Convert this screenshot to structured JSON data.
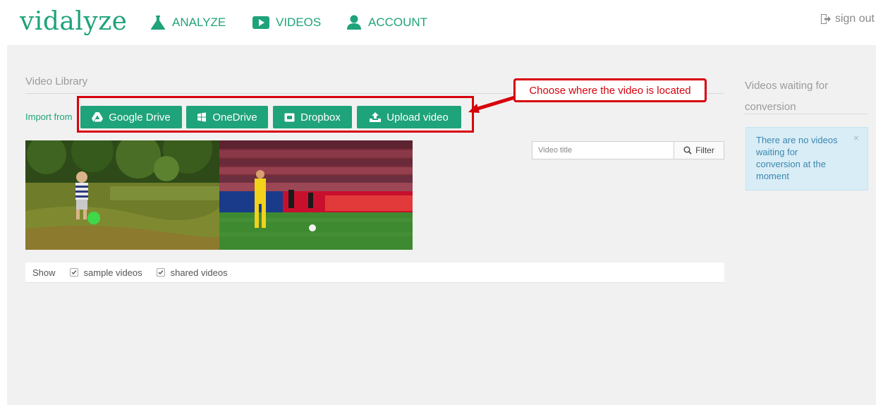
{
  "nav": {
    "logo": "vidalyze",
    "analyze": "ANALYZE",
    "videos": "VIDEOS",
    "account": "ACCOUNT",
    "signout": "sign out"
  },
  "library": {
    "title": "Video Library",
    "import_label": "Import from",
    "buttons": {
      "gdrive": "Google Drive",
      "onedrive": "OneDrive",
      "dropbox": "Dropbox",
      "upload": "Upload video"
    },
    "callout": "Choose where the video is located",
    "filter_placeholder": "Video title",
    "filter_button": "Filter",
    "show_label": "Show",
    "sample_videos": "sample videos",
    "shared_videos": "shared videos"
  },
  "sidebar": {
    "title": "Videos waiting for conversion",
    "message": "There are no videos waiting for conversion at the moment",
    "close": "×"
  },
  "colors": {
    "brand": "#1fa37a",
    "callout": "#d8000c",
    "info_bg": "#d9edf7",
    "info_text": "#3a87ad"
  }
}
